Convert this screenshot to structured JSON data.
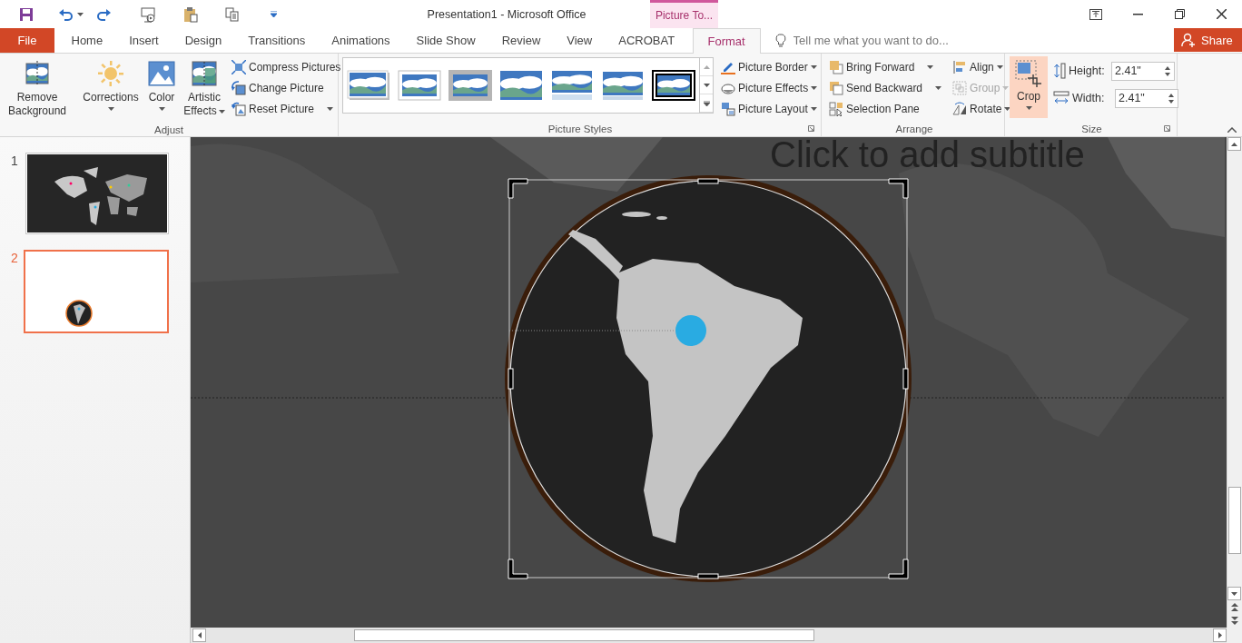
{
  "window": {
    "title": "Presentation1 - Microsoft Office",
    "context_tab": "Picture To..."
  },
  "tabs": [
    {
      "label": "File",
      "kind": "file",
      "selected": false
    },
    {
      "label": "Home",
      "kind": "tab",
      "selected": false
    },
    {
      "label": "Insert",
      "kind": "tab",
      "selected": false
    },
    {
      "label": "Design",
      "kind": "tab",
      "selected": false
    },
    {
      "label": "Transitions",
      "kind": "tab",
      "selected": false
    },
    {
      "label": "Animations",
      "kind": "tab",
      "selected": false
    },
    {
      "label": "Slide Show",
      "kind": "tab",
      "selected": false
    },
    {
      "label": "Review",
      "kind": "tab",
      "selected": false
    },
    {
      "label": "View",
      "kind": "tab",
      "selected": false
    },
    {
      "label": "ACROBAT",
      "kind": "tab",
      "selected": false
    },
    {
      "label": "Format",
      "kind": "context",
      "selected": true
    }
  ],
  "tell_me": {
    "placeholder": "Tell me what you want to do..."
  },
  "share": "Share",
  "ribbon": {
    "adjust": {
      "label": "Adjust",
      "large": [
        {
          "label": "Remove Background",
          "dropdown": false
        },
        {
          "label": "Corrections",
          "dropdown": true
        },
        {
          "label": "Color",
          "dropdown": true
        },
        {
          "label": "Artistic Effects",
          "dropdown": true
        }
      ],
      "small": [
        {
          "label": "Compress Pictures",
          "dropdown": false
        },
        {
          "label": "Change Picture",
          "dropdown": false
        },
        {
          "label": "Reset Picture",
          "dropdown": true
        }
      ]
    },
    "styles": {
      "label": "Picture Styles",
      "gallery": [
        {
          "kind": "shadow"
        },
        {
          "kind": "white-frame"
        },
        {
          "kind": "grey-frame"
        },
        {
          "kind": "soft-edge"
        },
        {
          "kind": "reflection"
        },
        {
          "kind": "soft-reflection"
        },
        {
          "kind": "black-frame"
        }
      ],
      "buttons": [
        {
          "label": "Picture Border"
        },
        {
          "label": "Picture Effects"
        },
        {
          "label": "Picture Layout"
        }
      ]
    },
    "arrange": {
      "label": "Arrange",
      "buttons": [
        {
          "label": "Bring Forward",
          "disabled": false
        },
        {
          "label": "Send Backward",
          "disabled": false
        },
        {
          "label": "Selection Pane",
          "disabled": false
        },
        {
          "label": "Align",
          "disabled": false
        },
        {
          "label": "Group",
          "disabled": true
        },
        {
          "label": "Rotate",
          "disabled": false
        }
      ]
    },
    "size": {
      "label": "Size",
      "crop": {
        "label": "Crop",
        "selected": true
      },
      "fields": [
        {
          "label": "Height:",
          "value": "2.41\""
        },
        {
          "label": "Width:",
          "value": "2.41\""
        }
      ]
    }
  },
  "slides": [
    {
      "number": "1",
      "kind": "world-map",
      "selected": false
    },
    {
      "number": "2",
      "kind": "circle-map",
      "selected": true
    }
  ],
  "canvas": {
    "subtitle": "Click to add subtitle"
  }
}
